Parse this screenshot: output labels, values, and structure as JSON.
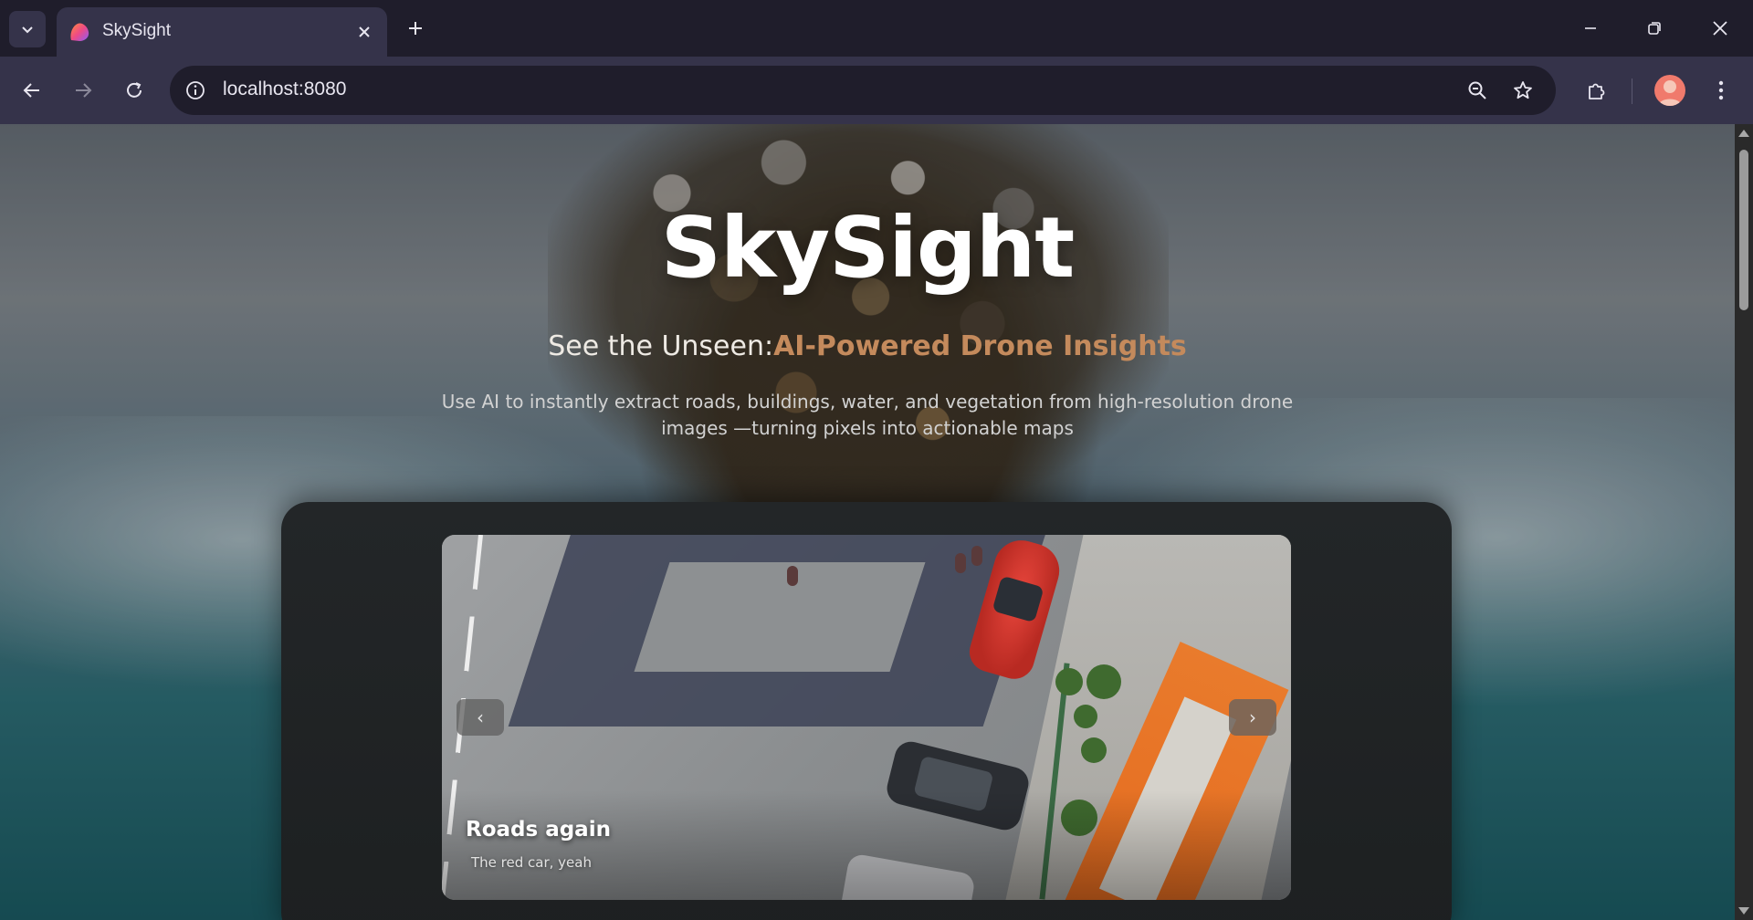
{
  "browser": {
    "tab_title": "SkySight",
    "url": "localhost:8080"
  },
  "hero": {
    "title": "SkySight",
    "subtitle_plain": "See the Unseen:",
    "subtitle_accent": "AI-Powered Drone Insights",
    "description": "Use AI to instantly extract roads, buildings, water, and vegetation from high-resolution drone images —turning pixels into actionable maps"
  },
  "carousel": {
    "slide_title": "Roads again",
    "slide_subtitle": "The red car, yeah",
    "prev_label": "‹",
    "next_label": "›"
  },
  "colors": {
    "accent": "#c48a5c",
    "chrome_bg": "#1f1d2b",
    "chrome_toolbar": "#35334a",
    "panel_bg": "#232628"
  },
  "icons": {
    "tab_dropdown": "chevron-down-icon",
    "favicon": "skysight-logo-icon",
    "tab_close": "close-icon",
    "new_tab": "plus-icon",
    "back": "arrow-left-icon",
    "forward": "arrow-right-icon",
    "reload": "reload-icon",
    "site_info": "info-icon",
    "zoom": "zoom-out-icon",
    "bookmark": "star-icon",
    "extensions": "puzzle-icon",
    "menu": "kebab-menu-icon"
  }
}
